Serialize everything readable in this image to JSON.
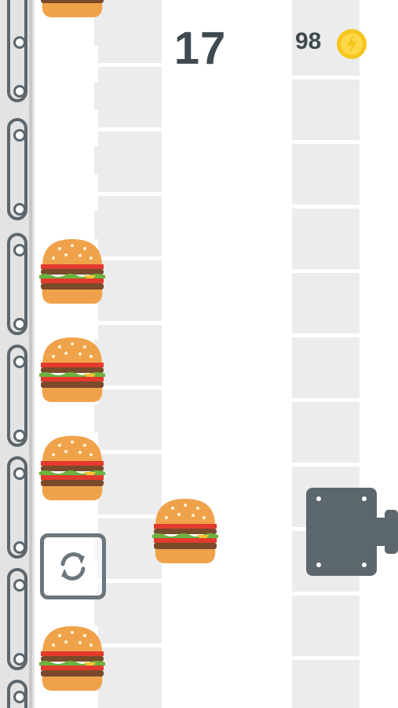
{
  "game": {
    "score": "17",
    "coins": "98"
  },
  "icons": {
    "coin": "coin-icon",
    "restart": "restart-icon",
    "burger": "burger-icon",
    "press": "press-machine"
  },
  "colors": {
    "text": "#3f4a50",
    "coin": "#f5c518",
    "bun": "#f0a24a",
    "patty": "#7a4a2a",
    "lettuce": "#6cb33f",
    "tomato": "#e23b2e",
    "cheese": "#f7c531",
    "metal": "#5c666d"
  }
}
